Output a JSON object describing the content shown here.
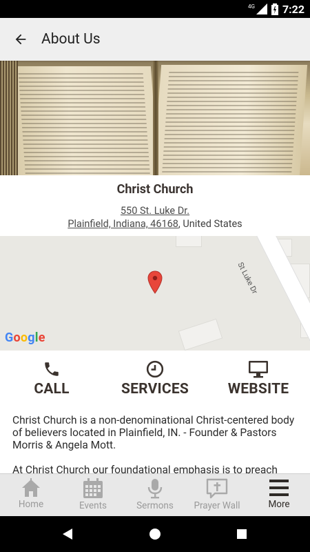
{
  "status_bar": {
    "network": "4G",
    "time": "7:22"
  },
  "app_bar": {
    "title": "About Us"
  },
  "church": {
    "name": "Christ Church",
    "address_line1": "550 St. Luke Dr.",
    "address_line2_link": "Plainfield, Indiana, 46168",
    "address_line2_suffix": ", United States"
  },
  "map": {
    "street_label": "St Luke Dr",
    "logo": "Google"
  },
  "actions": [
    {
      "label": "CALL",
      "icon": "phone-icon"
    },
    {
      "label": "SERVICES",
      "icon": "clock-icon"
    },
    {
      "label": "WEBSITE",
      "icon": "monitor-icon"
    }
  ],
  "description": {
    "p1": "Christ Church is a non-denominational Christ-centered body of believers located in Plainfield, IN. - Founder & Pastors Morris & Angela Mott.",
    "p2": "At Christ Church our foundational emphasis is to preach"
  },
  "bottom_nav": [
    {
      "label": "Home",
      "icon": "home-icon",
      "active": false
    },
    {
      "label": "Events",
      "icon": "calendar-icon",
      "active": false
    },
    {
      "label": "Sermons",
      "icon": "microphone-icon",
      "active": false
    },
    {
      "label": "Prayer Wall",
      "icon": "prayer-icon",
      "active": false
    },
    {
      "label": "More",
      "icon": "menu-icon",
      "active": true
    }
  ],
  "colors": {
    "accent_text": "#3b332e",
    "nav_inactive": "#9a9a9a",
    "app_bar_bg": "#efefef",
    "map_pin": "#e8463a"
  }
}
